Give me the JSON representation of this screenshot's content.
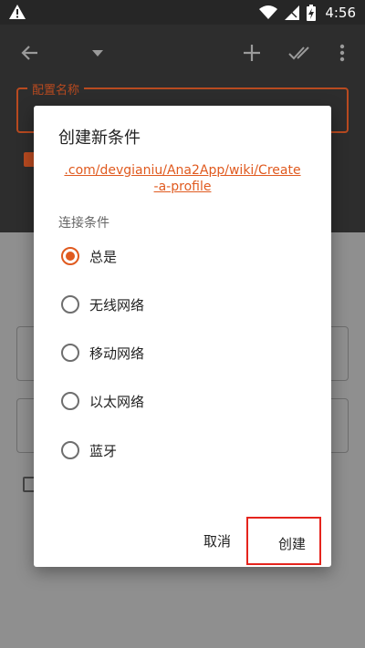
{
  "status_bar": {
    "time": "4:56",
    "icons": [
      "warning-icon",
      "wifi-icon",
      "signal-icon",
      "battery-charging-icon"
    ]
  },
  "toolbar": {
    "icons": [
      "back-arrow-icon",
      "dropdown-icon",
      "add-icon",
      "done-all-icon",
      "more-vert-icon"
    ],
    "config_label": "配置名称"
  },
  "dialog": {
    "title": "创建新条件",
    "link_line1": ".com/devgianiu/Ana2App/wiki/Create",
    "link_line2": "-a-profile",
    "section_label": "连接条件",
    "options": [
      {
        "label": "总是",
        "checked": true
      },
      {
        "label": "无线网络",
        "checked": false
      },
      {
        "label": "移动网络",
        "checked": false
      },
      {
        "label": "以太网络",
        "checked": false
      },
      {
        "label": "蓝牙",
        "checked": false
      }
    ],
    "cancel_label": "取消",
    "create_label": "创建"
  },
  "colors": {
    "accent": "#e05a1f",
    "highlight": "#e5241d",
    "toolbar_bg": "#2d2d2d",
    "scrim_bg": "#8f8f8f"
  }
}
